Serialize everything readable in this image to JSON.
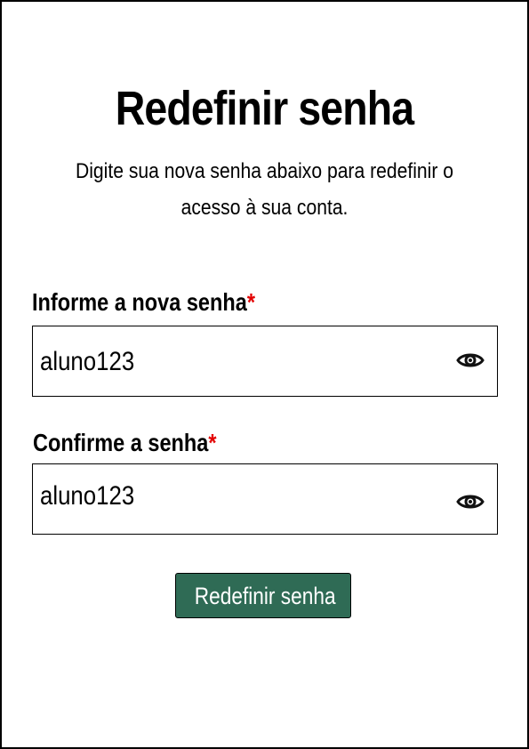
{
  "page": {
    "title": "Redefinir senha",
    "subtitle": "Digite sua nova senha abaixo para redefinir o acesso à sua conta."
  },
  "form": {
    "new_password": {
      "label": "Informe a nova senha",
      "required_mark": "*",
      "value": "aluno123",
      "toggle_icon": "eye-icon"
    },
    "confirm_password": {
      "label": "Confirme a senha",
      "required_mark": "*",
      "value": "aluno123",
      "toggle_icon": "eye-icon"
    },
    "submit_label": "Redefinir senha"
  },
  "colors": {
    "required": "#e30000",
    "button_background": "#2f6b55",
    "button_text": "#ffffff",
    "border": "#000000"
  }
}
